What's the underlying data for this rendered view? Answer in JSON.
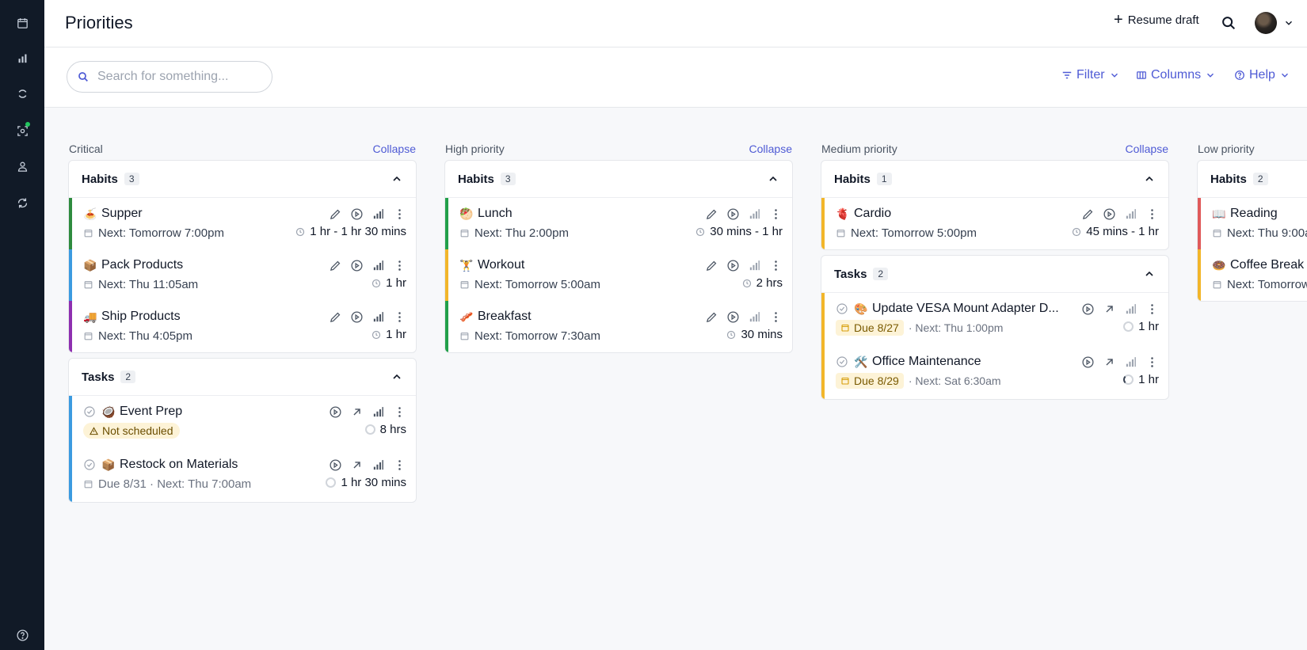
{
  "app": {
    "title": "Priorities"
  },
  "rail": {
    "items": [
      "calendar-icon",
      "stats-icon",
      "priorities-icon",
      "focus-icon",
      "team-icon",
      "sync-icon"
    ],
    "bottom": "help-icon"
  },
  "header": {
    "resume_label": "Resume draft"
  },
  "toolbar": {
    "search_placeholder": "Search for something...",
    "filter_label": "Filter",
    "columns_label": "Columns",
    "help_label": "Help"
  },
  "columns": [
    {
      "name": "Critical",
      "collapse": "Collapse",
      "habits": {
        "title": "Habits",
        "count": "3",
        "accent": "#22a04a",
        "items": [
          {
            "emoji": "🍝",
            "title": "Supper",
            "next": "Next: Tomorrow 7:00pm",
            "duration": "1 hr - 1 hr 30 mins",
            "bar": "#2e8b3e"
          },
          {
            "emoji": "📦",
            "title": "Pack Products",
            "next": "Next: Thu 11:05am",
            "duration": "1 hr",
            "bar": "#3b9be0"
          },
          {
            "emoji": "🚚",
            "title": "Ship Products",
            "next": "Next: Thu 4:05pm",
            "duration": "1 hr",
            "bar": "#8e2fb0"
          }
        ]
      },
      "tasks": {
        "title": "Tasks",
        "count": "2",
        "accent": "#3b9be0",
        "items": [
          {
            "emoji": "🥥",
            "title": "Event Prep",
            "badge": "Not scheduled",
            "duration": "8 hrs"
          },
          {
            "emoji": "📦",
            "title": "Restock on Materials",
            "due": "Due 8/31 · Next: Thu 7:00am",
            "duration": "1 hr 30 mins"
          }
        ]
      }
    },
    {
      "name": "High priority",
      "collapse": "Collapse",
      "habits": {
        "title": "Habits",
        "count": "3",
        "items": [
          {
            "emoji": "🥙",
            "title": "Lunch",
            "next": "Next: Thu 2:00pm",
            "duration": "30 mins - 1 hr",
            "bar": "#22a04a"
          },
          {
            "emoji": "🏋️",
            "title": "Workout",
            "next": "Next: Tomorrow 5:00am",
            "duration": "2 hrs",
            "bar": "#f2b62a"
          },
          {
            "emoji": "🥓",
            "title": "Breakfast",
            "next": "Next: Tomorrow 7:30am",
            "duration": "30 mins",
            "bar": "#22a04a"
          }
        ]
      }
    },
    {
      "name": "Medium priority",
      "collapse": "Collapse",
      "habits": {
        "title": "Habits",
        "count": "1",
        "items": [
          {
            "emoji": "🫀",
            "title": "Cardio",
            "next": "Next: Tomorrow 5:00pm",
            "duration": "45 mins - 1 hr",
            "bar": "#f2b62a"
          }
        ]
      },
      "tasks": {
        "title": "Tasks",
        "count": "2",
        "items": [
          {
            "emoji": "🎨",
            "title": "Update VESA Mount Adapter D...",
            "due_badge": "Due 8/27",
            "next": "· Next: Thu 1:00pm",
            "duration": "1 hr",
            "bar": "#f2b62a"
          },
          {
            "emoji": "🛠️",
            "title": "Office Maintenance",
            "due_badge": "Due 8/29",
            "next": "· Next: Sat 6:30am",
            "duration": "1 hr",
            "bar": "#f2b62a"
          }
        ]
      }
    },
    {
      "name": "Low priority",
      "habits": {
        "title": "Habits",
        "count": "2",
        "items": [
          {
            "emoji": "📖",
            "title": "Reading",
            "next": "Next: Thu 9:00a",
            "bar": "#e05a5a"
          },
          {
            "emoji": "🍩",
            "title": "Coffee Break",
            "next": "Next: Tomorrow",
            "bar": "#f2b62a"
          }
        ]
      }
    }
  ],
  "colors": {
    "accent": "#4f5bd5",
    "rail_bg": "#111a27",
    "badge_bg": "#fdf3d7"
  }
}
